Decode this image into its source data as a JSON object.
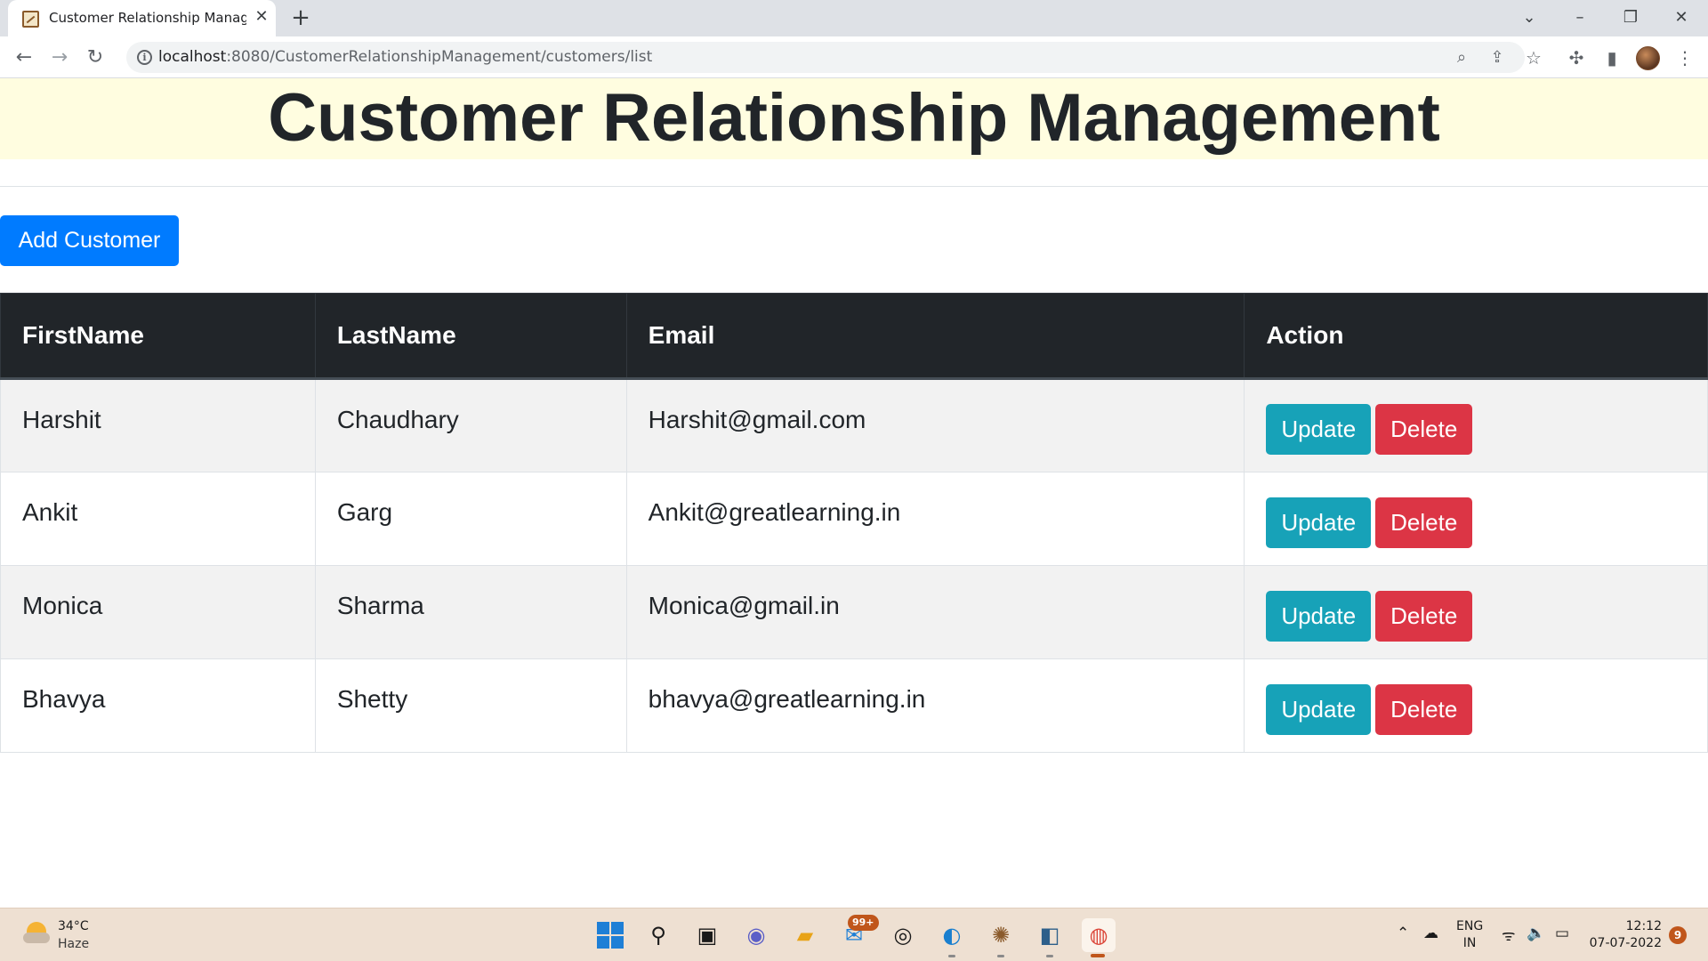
{
  "browser": {
    "tab_title": "Customer Relationship Management",
    "url_host": "localhost",
    "url_path": ":8080/CustomerRelationshipManagement/customers/list",
    "icons": [
      "favicon",
      "close-icon",
      "plus-icon",
      "chevron-down-icon",
      "minimize-icon",
      "restore-icon",
      "close-window-icon",
      "back-icon",
      "forward-icon",
      "reload-icon",
      "info-icon",
      "zoom-icon",
      "share-icon",
      "star-icon",
      "extensions-icon",
      "side-panel-icon",
      "avatar",
      "menu-icon"
    ]
  },
  "page": {
    "title": "Customer Relationship Management",
    "add_button": "Add Customer",
    "table": {
      "headers": [
        "FirstName",
        "LastName",
        "Email",
        "Action"
      ],
      "rows": [
        {
          "first": "Harshit",
          "last": "Chaudhary",
          "email": "Harshit@gmail.com"
        },
        {
          "first": "Ankit",
          "last": "Garg",
          "email": "Ankit@greatlearning.in"
        },
        {
          "first": "Monica",
          "last": "Sharma",
          "email": "Monica@gmail.in"
        },
        {
          "first": "Bhavya",
          "last": "Shetty",
          "email": "bhavya@greatlearning.in"
        }
      ],
      "update_label": "Update",
      "delete_label": "Delete"
    },
    "colors": {
      "header_band": "#fffde0",
      "primary": "#007bff",
      "info": "#17a2b8",
      "danger": "#dc3545",
      "table_dark": "#212529"
    }
  },
  "taskbar": {
    "temperature": "34°C",
    "condition": "Haze",
    "mail_badge": "99+",
    "lang_line1": "ENG",
    "lang_line2": "IN",
    "time": "12:12",
    "date": "07-07-2022",
    "notification_count": "9"
  }
}
